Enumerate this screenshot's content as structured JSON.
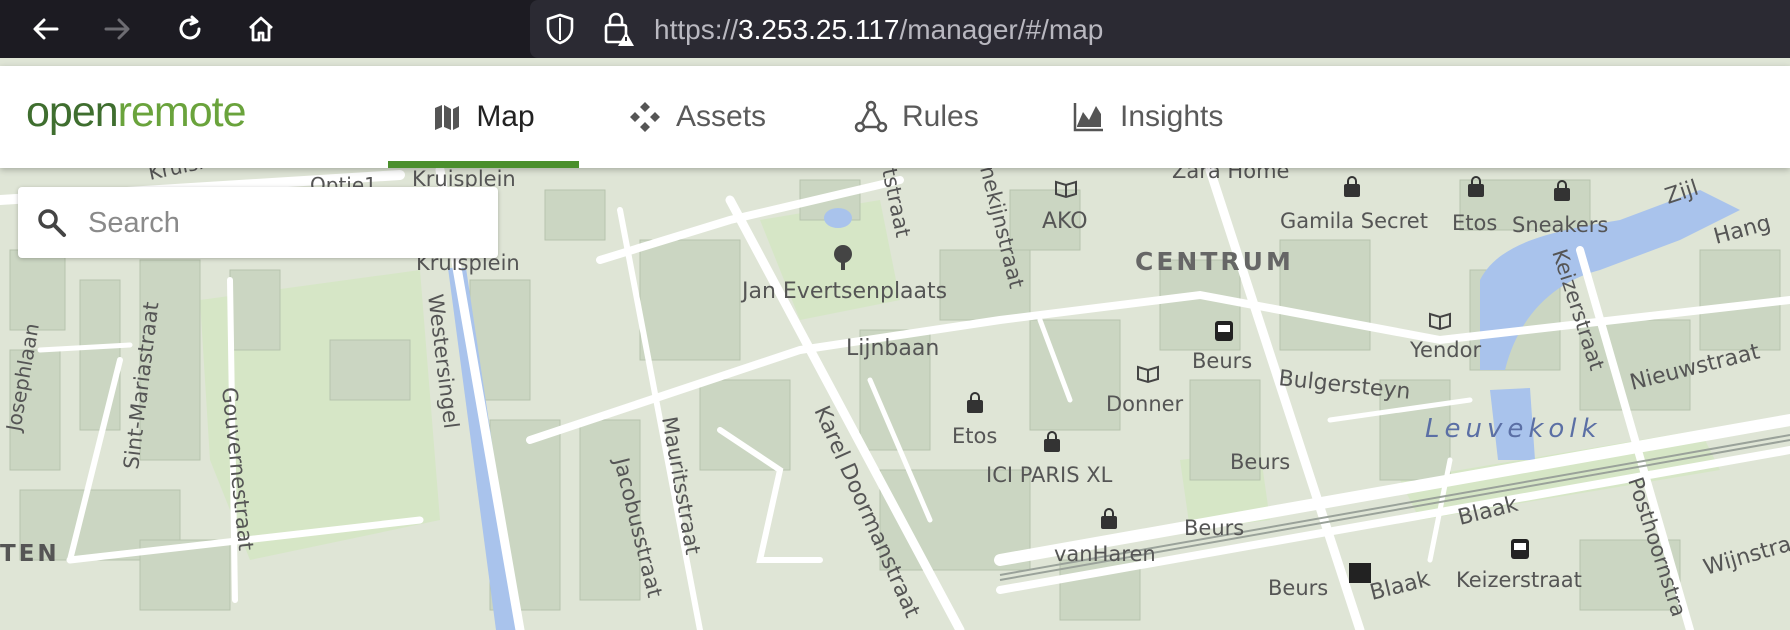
{
  "browser": {
    "url_prefix": "https://",
    "url_host": "3.253.25.117",
    "url_path": "/manager/#/map"
  },
  "app": {
    "logo_part1": "open",
    "logo_part2": "remote",
    "tabs": [
      {
        "label": "Map",
        "icon": "map-icon",
        "active": true
      },
      {
        "label": "Assets",
        "icon": "assets-icon",
        "active": false
      },
      {
        "label": "Rules",
        "icon": "rules-icon",
        "active": false
      },
      {
        "label": "Insights",
        "icon": "insights-icon",
        "active": false
      }
    ]
  },
  "search": {
    "placeholder": "Search"
  },
  "map": {
    "colors": {
      "building": "#cbd6c2",
      "road": "#ffffff",
      "water": "#a9c3ec",
      "park": "#d6e6c6",
      "ground": "#dfe5d6"
    },
    "labels": {
      "kruiskade": "Kruiskade",
      "optie1": "Optie1",
      "kruisplein_top": "Kruisplein",
      "kruisplein": "Kruisplein",
      "westersingel": "Westersingel",
      "josephlaan": "Josephlaan",
      "sint_mariastraat": "Sint-Mariastraat",
      "gouvernestraat": "Gouvernestraat",
      "ten": "TEN",
      "jacobusstraat": "Jacobusstraat",
      "mauritsstraat": "Mauritsstraat",
      "karel_doormanstraat": "Karel Doormanstraat",
      "jan_evertsenplaats": "Jan Evertsenplaats",
      "lijnbaan": "Lijnbaan",
      "tstraat": "tstraat",
      "nekijnstraat": "nekijnstraat",
      "ako": "AKO",
      "zara_home": "Zara Home",
      "centrum": "CENTRUM",
      "gamila_secret": "Gamila Secret",
      "etos_1": "Etos",
      "sneakers": "Sneakers",
      "zijl": "Zijl",
      "hang": "Hang",
      "keizerstraat_v": "Keizerstraat",
      "yendor": "Yendor",
      "beurs_1": "Beurs",
      "bulgersteyn": "Bulgersteyn",
      "nieuwstraat": "Nieuwstraat",
      "leuvekolk": "Leuvekolk",
      "donner": "Donner",
      "etos_2": "Etos",
      "ici_paris": "ICI PARIS XL",
      "beurs_2": "Beurs",
      "beurs_3": "Beurs",
      "vanharen": "vanHaren",
      "beurs_4": "Beurs",
      "blaak_1": "Blaak",
      "blaak_2": "Blaak",
      "keizerstraat": "Keizerstraat",
      "posthoornstraat": "Posthoornstra",
      "wijnstraat": "Wijnstra"
    }
  }
}
